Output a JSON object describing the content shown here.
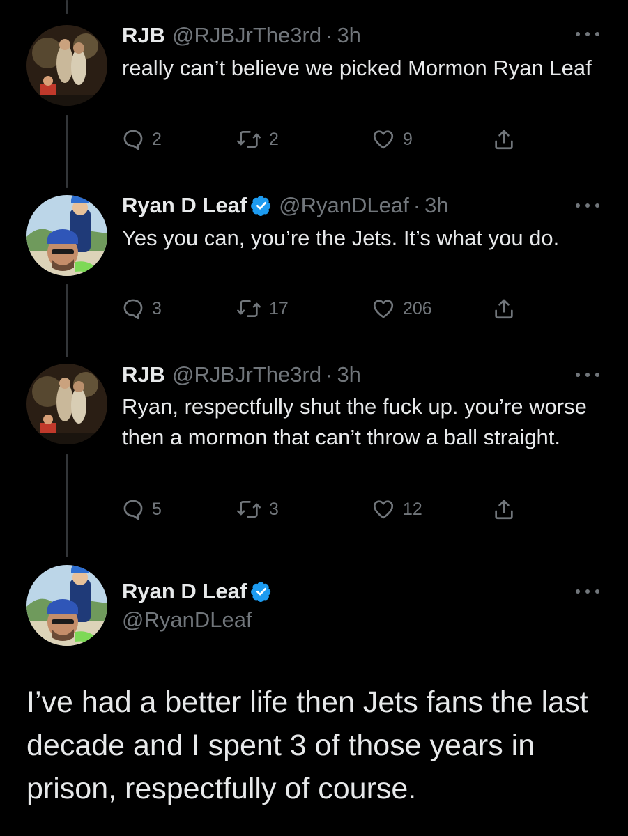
{
  "colors": {
    "background": "#000000",
    "text": "#e7e9ea",
    "muted": "#71767b",
    "verified": "#1d9bf0",
    "thread_line": "#333639"
  },
  "tweets": [
    {
      "name": "RJB",
      "handle": "@RJBJrThe3rd",
      "separator": "·",
      "time": "3h",
      "verified": false,
      "text": "really can’t believe we picked Mormon Ryan Leaf",
      "replies": "2",
      "retweets": "2",
      "likes": "9",
      "avatar": "rjb-avatar"
    },
    {
      "name": "Ryan D Leaf",
      "handle": "@RyanDLeaf",
      "separator": "·",
      "time": "3h",
      "verified": true,
      "text": "Yes you can, you’re the Jets. It’s what you do.",
      "replies": "3",
      "retweets": "17",
      "likes": "206",
      "avatar": "ryan-leaf-avatar"
    },
    {
      "name": "RJB",
      "handle": "@RJBJrThe3rd",
      "separator": "·",
      "time": "3h",
      "verified": false,
      "text": "Ryan, respectfully shut the fuck up. you’re worse then a mormon that can’t throw a ball straight.",
      "replies": "5",
      "retweets": "3",
      "likes": "12",
      "avatar": "rjb-avatar"
    }
  ],
  "main_tweet": {
    "name": "Ryan D Leaf",
    "handle": "@RyanDLeaf",
    "verified": true,
    "text": "I’ve had a better life then Jets fans the last decade and I spent 3 of those years in prison, respectfully of course.",
    "avatar": "ryan-leaf-avatar"
  },
  "icons": {
    "reply": "reply-icon",
    "retweet": "retweet-icon",
    "like": "heart-icon",
    "share": "share-icon",
    "more": "more-icon",
    "verified": "verified-badge-icon"
  }
}
